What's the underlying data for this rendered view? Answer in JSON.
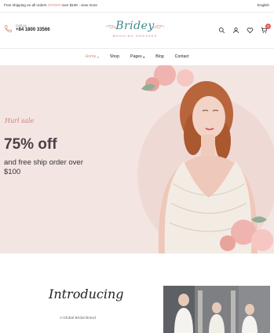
{
  "topbar": {
    "promo_before": "Free shipping on all orders ",
    "promo_highlight": "ORDER",
    "promo_after": " over $100 - view more",
    "language": "English"
  },
  "header": {
    "call_label": "Call us",
    "call_number": "+84 1800 33566",
    "logo_name": "Bridey",
    "logo_sub": "WEDDING DRESSES",
    "cart_count": "0"
  },
  "nav": {
    "items": [
      {
        "label": "Home",
        "caret": "▾"
      },
      {
        "label": "Shop",
        "caret": ""
      },
      {
        "label": "Pages",
        "caret": "▾"
      },
      {
        "label": "Blog",
        "caret": ""
      },
      {
        "label": "Contact",
        "caret": ""
      }
    ]
  },
  "hero": {
    "script": "Hurl sale",
    "headline": "75% off",
    "subline": "and free ship order over $100"
  },
  "intro": {
    "script": "Introducing",
    "subtitle": "A Global Bridal Brand"
  },
  "colors": {
    "accent": "#d98b83",
    "logo_teal": "#3a8a8a",
    "hero_bg": "#f3e5e2",
    "badge": "#e05a5a"
  }
}
